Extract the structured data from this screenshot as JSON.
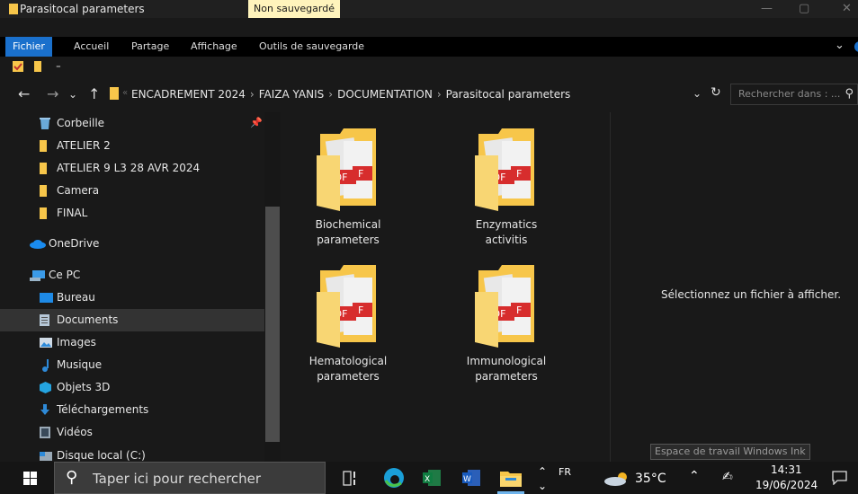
{
  "window": {
    "title": "Parasitocal parameters",
    "unsaved_badge": "Non sauvegardé"
  },
  "ribbon": {
    "tabs": [
      "Fichier",
      "Accueil",
      "Partage",
      "Affichage",
      "Outils de sauvegarde"
    ],
    "active_tab": "Fichier"
  },
  "address": {
    "crumbs": [
      "ENCADREMENT 2024",
      "FAIZA YANIS",
      "DOCUMENTATION",
      "Parasitocal parameters"
    ],
    "search_placeholder": "Rechercher dans : ..."
  },
  "nav_pane": {
    "items": [
      {
        "label": "Corbeille",
        "icon": "recycle-bin-icon"
      },
      {
        "label": "ATELIER 2",
        "icon": "folder-icon"
      },
      {
        "label": "ATELIER 9 L3 28 AVR 2024",
        "icon": "folder-icon"
      },
      {
        "label": "Camera",
        "icon": "folder-icon"
      },
      {
        "label": "FINAL",
        "icon": "folder-icon"
      },
      {
        "label": "OneDrive",
        "icon": "onedrive-icon"
      },
      {
        "label": "Ce PC",
        "icon": "this-pc-icon"
      },
      {
        "label": "Bureau",
        "icon": "desktop-icon"
      },
      {
        "label": "Documents",
        "icon": "documents-icon"
      },
      {
        "label": "Images",
        "icon": "images-icon"
      },
      {
        "label": "Musique",
        "icon": "music-icon"
      },
      {
        "label": "Objets 3D",
        "icon": "3d-objects-icon"
      },
      {
        "label": "Téléchargements",
        "icon": "downloads-icon"
      },
      {
        "label": "Vidéos",
        "icon": "videos-icon"
      },
      {
        "label": "Disque local (C:)",
        "icon": "drive-icon"
      }
    ],
    "selected": "Documents"
  },
  "files": [
    {
      "name_line1": "Biochemical",
      "name_line2": "parameters"
    },
    {
      "name_line1": "Enzymatics",
      "name_line2": "activitis"
    },
    {
      "name_line1": "Hematological",
      "name_line2": "parameters"
    },
    {
      "name_line1": "Immunological",
      "name_line2": "parameters"
    }
  ],
  "preview": {
    "message": "Sélectionnez un fichier à afficher."
  },
  "ink_tooltip": "Espace de travail Windows Ink",
  "taskbar": {
    "search_placeholder": "Taper ici pour rechercher",
    "language": "FR",
    "weather": "35°C",
    "time": "14:31",
    "date": "19/06/2024"
  },
  "colors": {
    "accent": "#1a70cc",
    "folder": "#f7c64a",
    "pdf_red": "#d72d2d"
  }
}
